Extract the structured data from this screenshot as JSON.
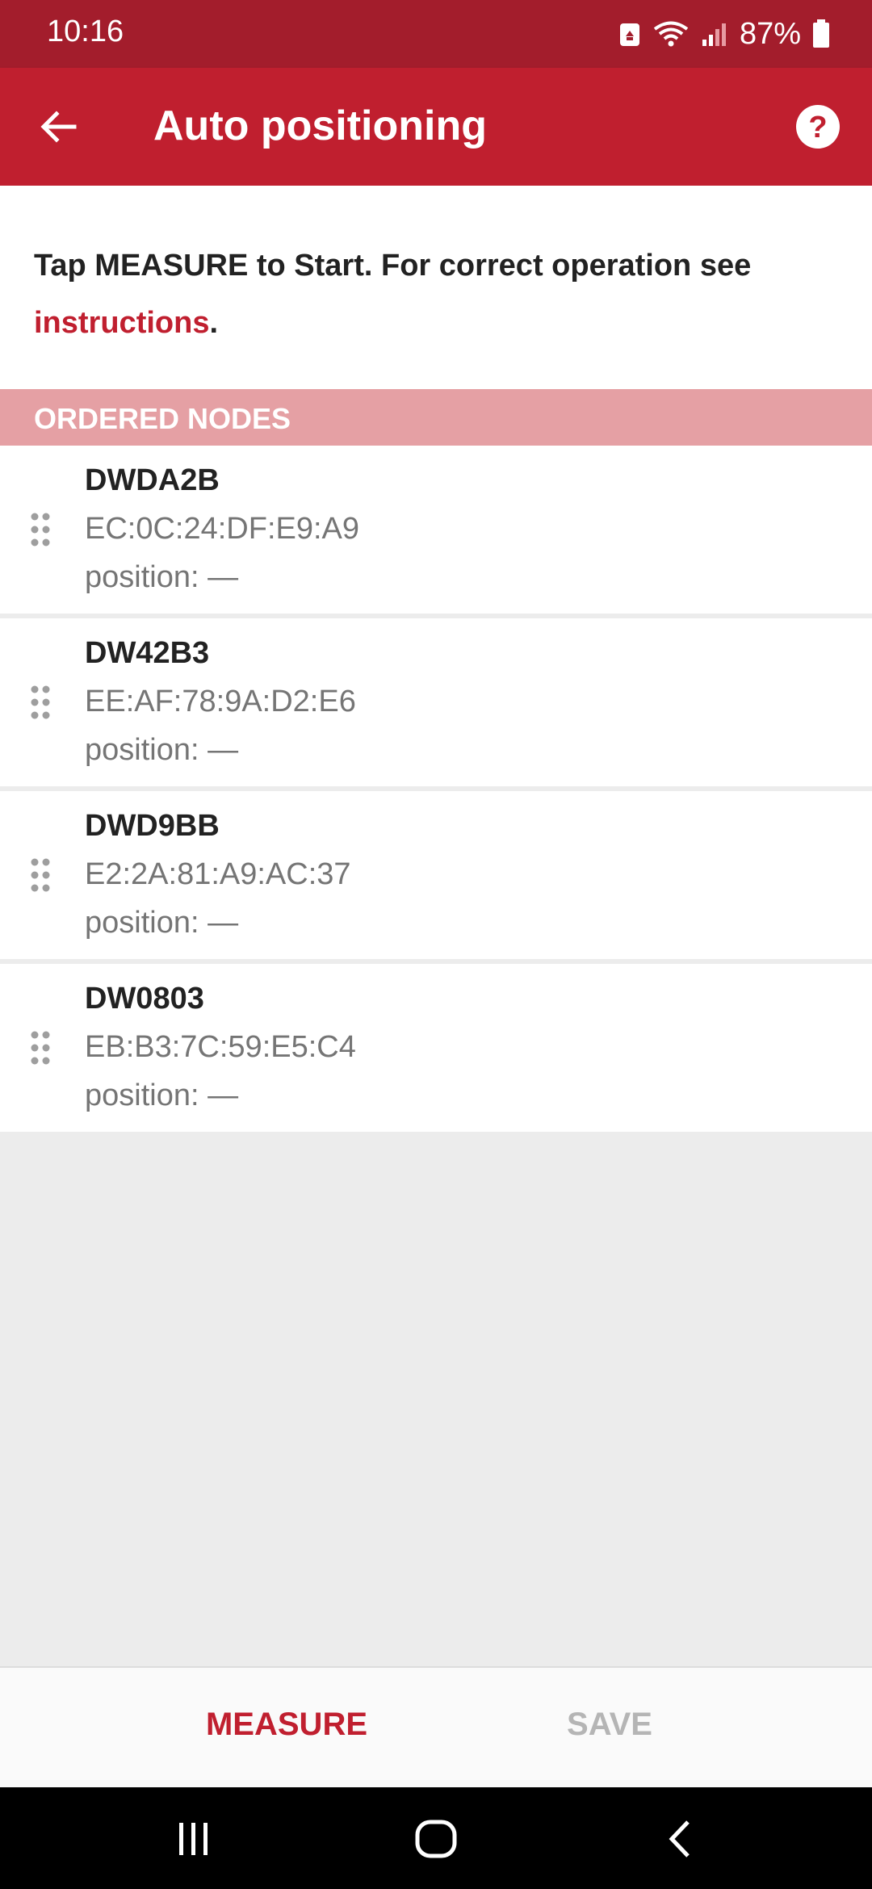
{
  "status_bar": {
    "time": "10:16",
    "battery_percent": "87%",
    "icons": [
      "recycle-notification-icon",
      "wifi-icon",
      "signal-icon",
      "battery-icon"
    ]
  },
  "app_bar": {
    "title": "Auto positioning",
    "back_icon": "arrow-left-icon",
    "help_icon": "help-circle-icon"
  },
  "instructions": {
    "text": "Tap MEASURE to Start. For correct operation see ",
    "link_text": "instructions",
    "suffix": "."
  },
  "section": {
    "header": "ORDERED NODES"
  },
  "nodes": [
    {
      "name": "DWDA2B",
      "mac": "EC:0C:24:DF:E9:A9",
      "position": "position: —"
    },
    {
      "name": "DW42B3",
      "mac": "EE:AF:78:9A:D2:E6",
      "position": "position: —"
    },
    {
      "name": "DWD9BB",
      "mac": "E2:2A:81:A9:AC:37",
      "position": "position: —"
    },
    {
      "name": "DW0803",
      "mac": "EB:B3:7C:59:E5:C4",
      "position": "position: —"
    }
  ],
  "actions": {
    "measure": "MEASURE",
    "save": "SAVE"
  },
  "colors": {
    "primary": "#c01f2f",
    "status_bar": "#a31d2c",
    "section_header": "#e5a0a4",
    "disabled": "#b5b5b5"
  }
}
